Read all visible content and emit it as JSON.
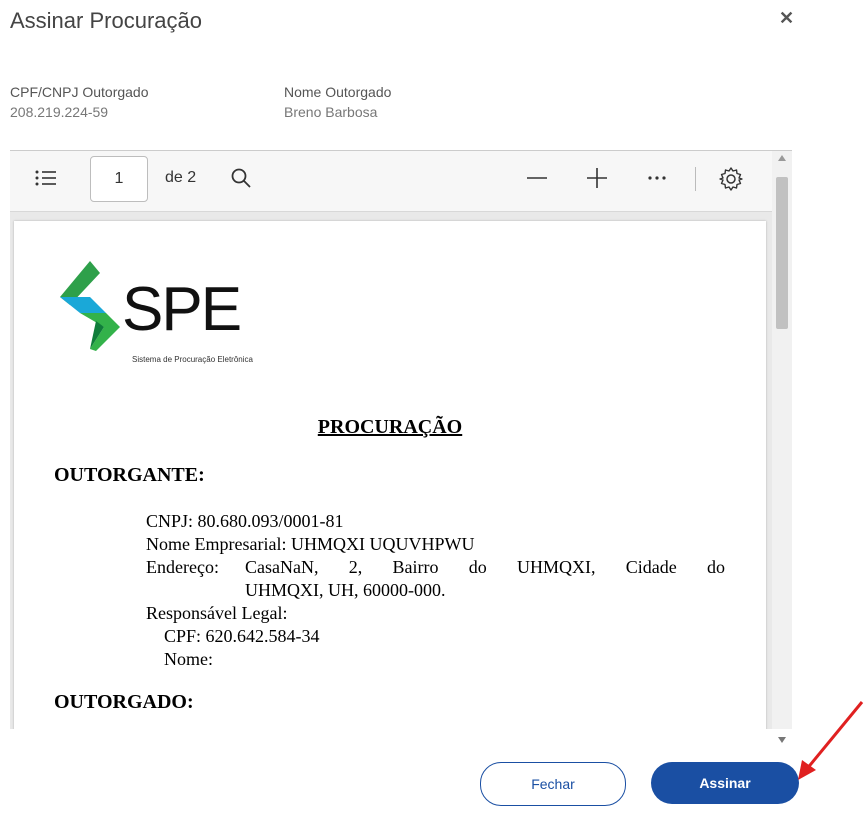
{
  "dialog": {
    "title": "Assinar Procuração",
    "close_icon": "close-icon"
  },
  "grantee": {
    "cpf_label": "CPF/CNPJ Outorgado",
    "cpf_value": "208.219.224-59",
    "name_label": "Nome Outorgado",
    "name_value": "Breno Barbosa"
  },
  "viewer": {
    "toolbar": {
      "toc_icon": "list-icon",
      "page_number": "1",
      "page_of": "de 2",
      "search_icon": "search-icon",
      "zoom_out_icon": "minus-icon",
      "zoom_in_icon": "plus-icon",
      "more_icon": "more-icon",
      "settings_icon": "gear-icon"
    },
    "document": {
      "logo_text": "SPE",
      "logo_subtitle": "Sistema de Procuração Eletrônica",
      "title": "PROCURAÇÃO",
      "outorgante_heading": "OUTORGANTE:",
      "cnpj": "CNPJ: 80.680.093/0001-81",
      "nome_empresarial": "Nome Empresarial: UHMQXI UQUVHPWU",
      "endereco_label": "Endereço:",
      "endereco_line1": "CasaNaN, 2, Bairro do UHMQXI, Cidade do",
      "endereco_line2": "UHMQXI, UH, 60000-000.",
      "responsavel": "Responsável Legal:",
      "resp_cpf": "CPF: 620.642.584-34",
      "resp_nome": "Nome:",
      "outorgado_heading": "OUTORGADO:"
    }
  },
  "actions": {
    "close_label": "Fechar",
    "sign_label": "Assinar"
  },
  "colors": {
    "primary": "#1a4fa3",
    "annotation_arrow": "#e02020"
  }
}
